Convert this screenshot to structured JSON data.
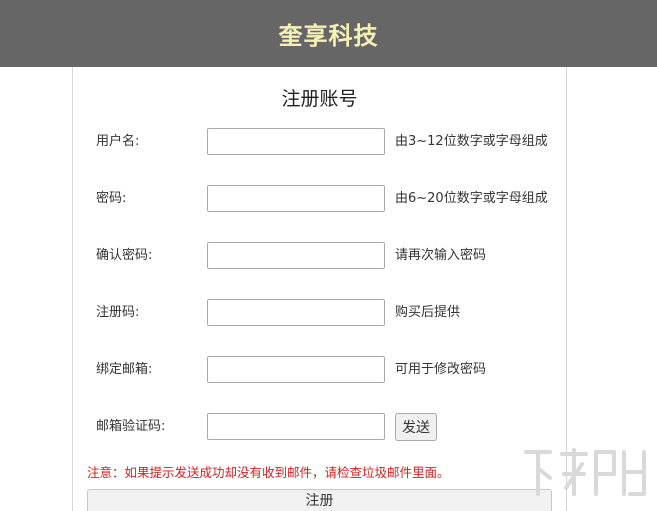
{
  "header": {
    "title": "奎享科技"
  },
  "form": {
    "title": "注册账号",
    "fields": [
      {
        "label": "用户名:",
        "value": "",
        "hint": "由3~12位数字或字母组成"
      },
      {
        "label": "密码:",
        "value": "",
        "hint": "由6~20位数字或字母组成"
      },
      {
        "label": "确认密码:",
        "value": "",
        "hint": "请再次输入密码"
      },
      {
        "label": "注册码:",
        "value": "",
        "hint": "购买后提供"
      },
      {
        "label": "绑定邮箱:",
        "value": "",
        "hint": "可用于修改密码"
      },
      {
        "label": "邮箱验证码:",
        "value": ""
      }
    ],
    "send_label": "发送",
    "notice": "注意：如果提示发送成功却没有收到邮件，请检查垃圾邮件里面。",
    "submit_label": "注册"
  },
  "colors": {
    "header_bg": "#666666",
    "header_text": "#f7f0b4",
    "notice_text": "#d21f1f"
  }
}
